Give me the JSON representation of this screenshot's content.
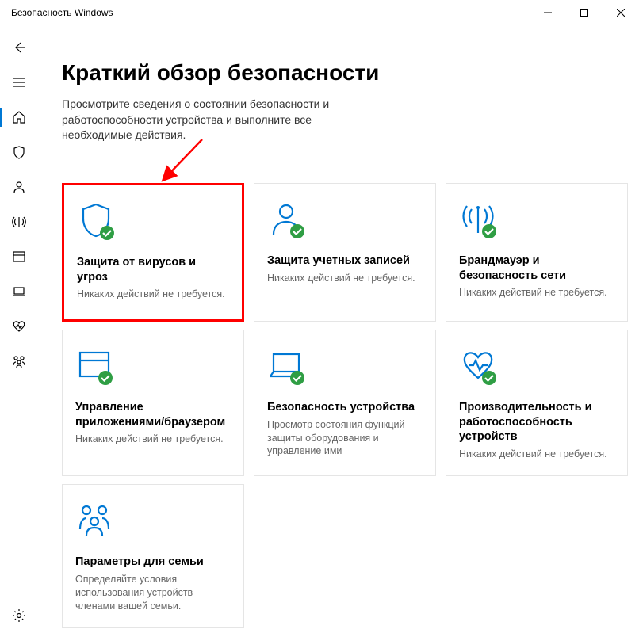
{
  "window": {
    "title": "Безопасность Windows"
  },
  "main": {
    "heading": "Краткий обзор безопасности",
    "subtitle": "Просмотрите сведения о состоянии безопасности и работоспособности устройства и выполните все необходимые действия."
  },
  "tiles": [
    {
      "title": "Защита от вирусов и угроз",
      "desc": "Никаких действий не требуется.",
      "highlighted": true,
      "check": true
    },
    {
      "title": "Защита учетных записей",
      "desc": "Никаких действий не требуется.",
      "check": true
    },
    {
      "title": "Брандмауэр и безопасность сети",
      "desc": "Никаких действий не требуется.",
      "check": true
    },
    {
      "title": "Управление приложениями/браузером",
      "desc": "Никаких действий не требуется.",
      "check": true
    },
    {
      "title": "Безопасность устройства",
      "desc": "Просмотр состояния функций защиты оборудования и управление ими",
      "check": true
    },
    {
      "title": "Производительность и работоспособность устройств",
      "desc": "Никаких действий не требуется.",
      "check": true
    },
    {
      "title": "Параметры для семьи",
      "desc": "Определяйте условия использования устройств членами вашей семьи.",
      "check": false
    }
  ],
  "colors": {
    "accent": "#0078d4",
    "ok": "#2f9e44",
    "annotation": "#ff0000"
  }
}
